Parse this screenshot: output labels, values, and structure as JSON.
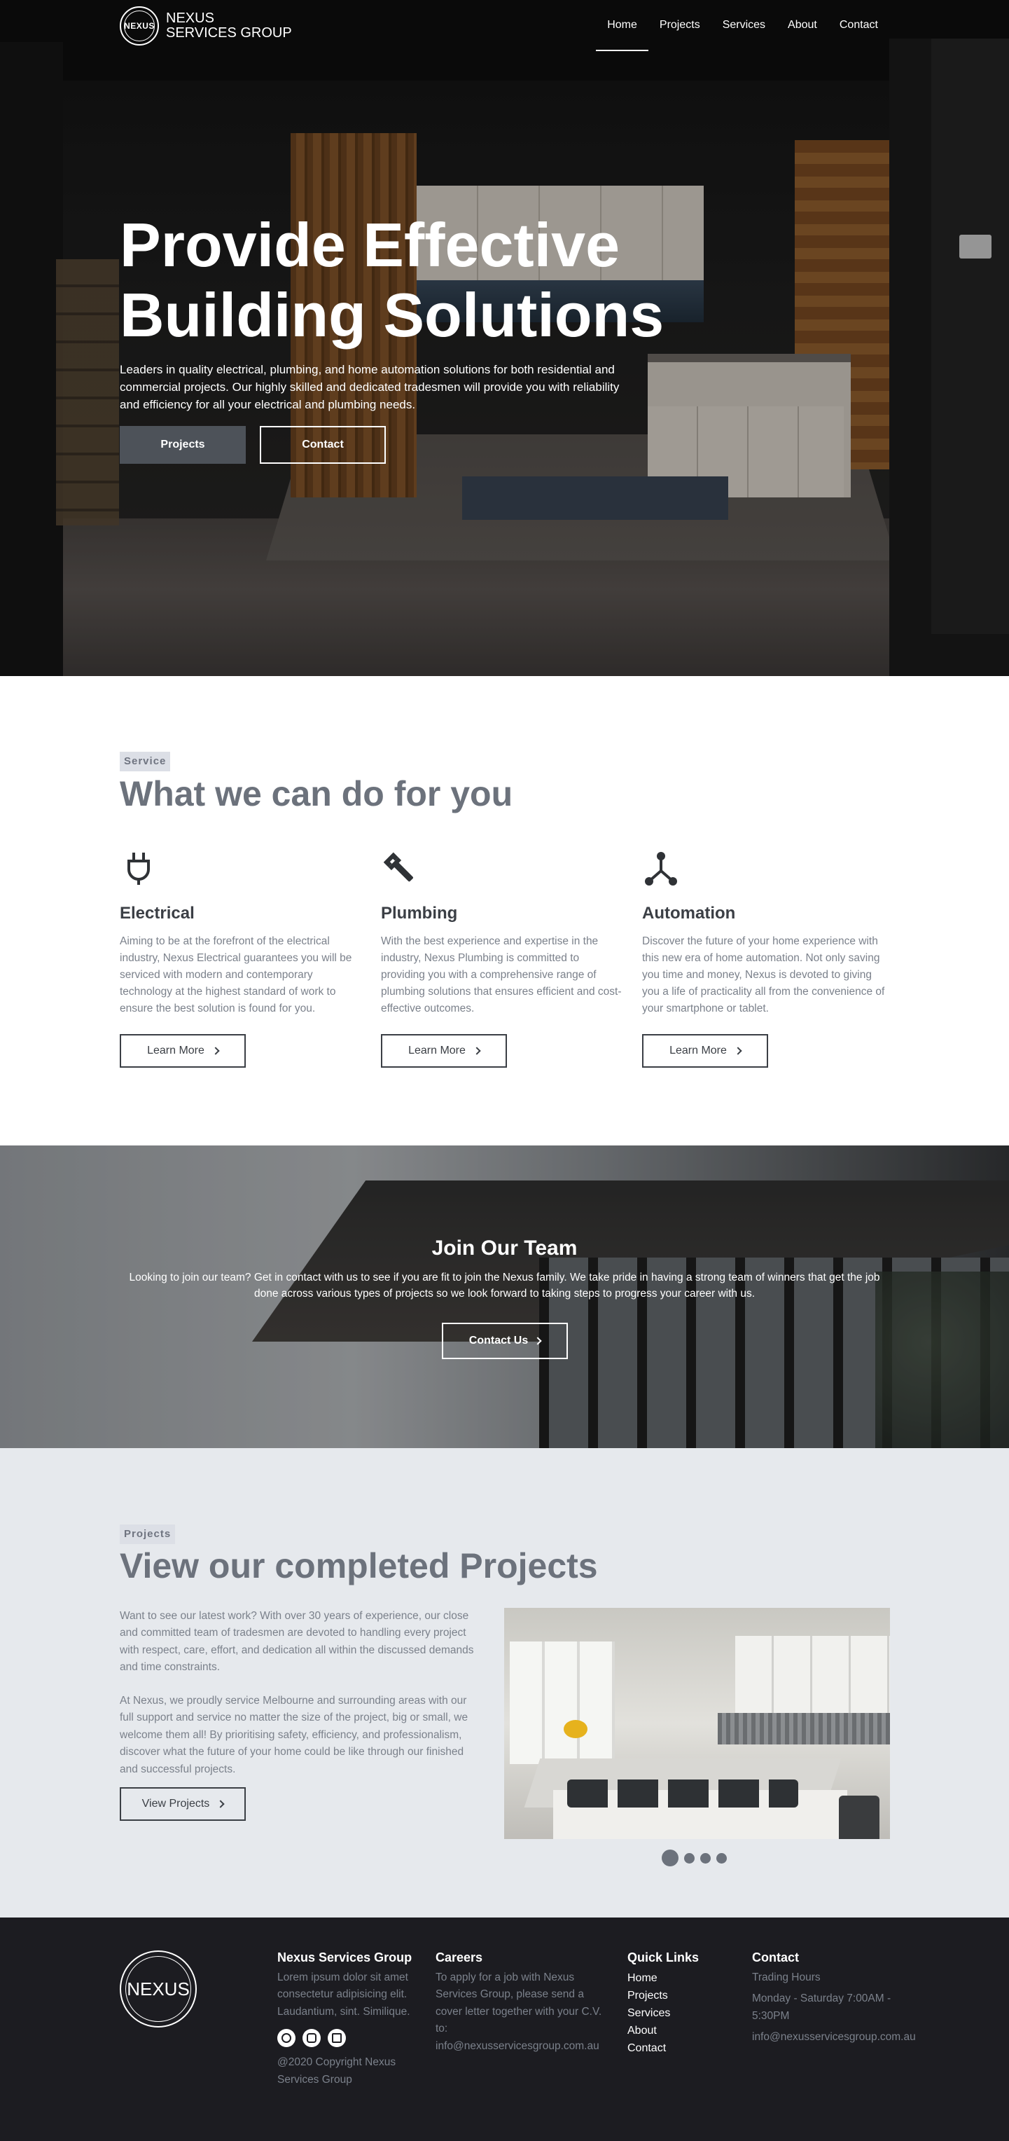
{
  "nav": {
    "logo_mark": "NEXUS",
    "brand_line1": "NEXUS",
    "brand_line2": "SERVICES GROUP",
    "links": [
      "Home",
      "Projects",
      "Services",
      "About",
      "Contact"
    ],
    "active": "Home"
  },
  "hero": {
    "title_line1": "Provide Effective",
    "title_line2": "Building Solutions",
    "description": "Leaders in quality electrical, plumbing, and home automation solutions for both residential and commercial projects. Our highly skilled and dedicated tradesmen will provide you with reliability and efficiency for all your electrical and plumbing needs.",
    "primary_button": "Projects",
    "secondary_button": "Contact"
  },
  "services": {
    "tag": "Service",
    "title": "What we can do for you",
    "items": [
      {
        "icon": "plug-icon",
        "title": "Electrical",
        "text": "Aiming to be at the forefront of the electrical industry, Nexus Electrical guarantees you will be serviced with modern and contemporary technology at the highest standard of work to ensure the best solution is found for you.",
        "button": "Learn More"
      },
      {
        "icon": "wrench-icon",
        "title": "Plumbing",
        "text": "With the best experience and expertise in the industry, Nexus Plumbing is committed to providing you with a comprehensive range of plumbing solutions that ensures efficient and cost-effective outcomes.",
        "button": "Learn More"
      },
      {
        "icon": "network-icon",
        "title": "Automation",
        "text": "Discover the future of your home experience with this new era of home automation. Not only saving you time and money, Nexus is devoted to giving you a life of practicality all from the convenience of your smartphone or tablet.",
        "button": "Learn More"
      }
    ]
  },
  "join": {
    "title": "Join Our Team",
    "text": "Looking to join our team? Get in contact with us to see if you are fit to join the Nexus family. We take pride in having a strong team of winners that get the job done across various types of projects so we look forward to taking steps to progress your career with us.",
    "button": "Contact Us"
  },
  "projects": {
    "tag": "Projects",
    "title": "View our completed Projects",
    "paragraph1": "Want to see our latest work? With over 30 years of experience, our close and committed team of tradesmen are devoted to handling every project with respect, care, effort, and dedication all within the discussed demands and time constraints.",
    "paragraph2": "At Nexus, we proudly service Melbourne and surrounding areas with our full support and service no matter the size of the project, big or small, we welcome them all! By prioritising safety, efficiency, and professionalism, discover what the future of your home could be like through our finished and successful projects.",
    "button": "View Projects",
    "carousel_slides": 4,
    "carousel_active": 1
  },
  "footer": {
    "logo_mark": "NEXUS",
    "about_title": "Nexus Services Group",
    "about_text": "Lorem ipsum dolor sit amet consectetur adipisicing elit. Laudantium, sint. Similique.",
    "copyright": "@2020 Copyright Nexus Services Group",
    "careers_title": "Careers",
    "careers_text": "To apply for a job with Nexus Services Group, please send a cover letter together with your C.V. to: info@nexusservicesgroup.com.au",
    "quick_links_title": "Quick Links",
    "quick_links": [
      "Home",
      "Projects",
      "Services",
      "About",
      "Contact"
    ],
    "contact_title": "Contact",
    "trading_hours_label": "Trading Hours",
    "trading_hours": "Monday - Saturday 7:00AM - 5:30PM",
    "email": "info@nexusservicesgroup.com.au",
    "social": [
      "facebook-icon",
      "instagram-icon",
      "linkedin-icon"
    ]
  },
  "colors": {
    "accent_gray": "#4d5259",
    "title_gray": "#6c727c",
    "tag_bg": "#dcdfe6",
    "projects_bg": "#e6e9ed",
    "footer_bg": "#1c1c21"
  }
}
